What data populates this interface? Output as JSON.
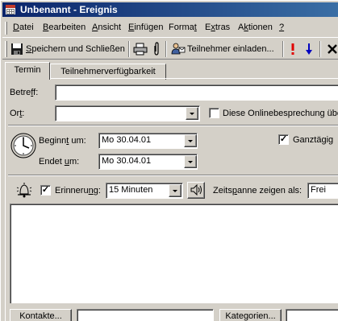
{
  "window": {
    "title": "Unbenannt - Ereignis"
  },
  "menu": {
    "items": [
      {
        "pre": "",
        "key": "D",
        "post": "atei"
      },
      {
        "pre": "",
        "key": "B",
        "post": "earbeiten"
      },
      {
        "pre": "",
        "key": "A",
        "post": "nsicht"
      },
      {
        "pre": "",
        "key": "E",
        "post": "infügen"
      },
      {
        "pre": "Forma",
        "key": "t",
        "post": ""
      },
      {
        "pre": "E",
        "key": "x",
        "post": "tras"
      },
      {
        "pre": "A",
        "key": "k",
        "post": "tionen"
      },
      {
        "pre": "",
        "key": "?",
        "post": ""
      }
    ]
  },
  "toolbar": {
    "save_close_pre": "",
    "save_close_key": "S",
    "save_close_post": "peichern und Schließen",
    "invite_label": "Teilnehmer einladen..."
  },
  "tabs": {
    "termin": "Termin",
    "availability": "Teilnehmerverfügbarkeit"
  },
  "form": {
    "subject_label_pre": "Betre",
    "subject_label_key": "f",
    "subject_label_post": "f:",
    "subject_value": "",
    "location_label_pre": "Or",
    "location_label_key": "t",
    "location_label_post": ":",
    "location_value": "",
    "online_label": "Diese Onlinebesprechung über",
    "start_label_pre": "Beginn",
    "start_label_key": "t",
    "start_label_post": " um:",
    "start_value": "Mo 30.04.01",
    "end_label_pre": "Endet ",
    "end_label_key": "u",
    "end_label_post": "m:",
    "end_value": "Mo 30.04.01",
    "allday_label_pre": "Ganztä",
    "allday_label_key": "g",
    "allday_label_post": "ig",
    "allday_checked": true,
    "reminder_label_pre": "Erinneru",
    "reminder_label_key": "n",
    "reminder_label_post": "g:",
    "reminder_checked": true,
    "reminder_value": "15 Minuten",
    "showas_label_pre": "Zeits",
    "showas_label_key": "p",
    "showas_label_post": "anne zeigen als:",
    "showas_value": "Frei",
    "contacts_button": "Kontakte...",
    "contacts_value": "",
    "categories_button": "Kategorien...",
    "categories_value": ""
  },
  "colors": {
    "title_start": "#0a246a",
    "title_end": "#3a6ea5",
    "face": "#d4d0c8",
    "delete_x": "#000000",
    "importance_high": "#e00000",
    "importance_low": "#0000c0"
  },
  "icons": [
    "calendar-app-icon",
    "save-icon",
    "print-icon",
    "paperclip-icon",
    "invite-attendees-icon",
    "high-importance-icon",
    "low-importance-icon",
    "delete-icon",
    "clock-icon",
    "bell-icon",
    "speaker-icon"
  ]
}
